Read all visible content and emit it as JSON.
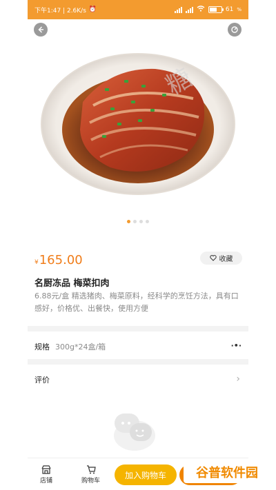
{
  "status_bar": {
    "time_speed": "下午1:47 | 2.6K/s",
    "battery": "61",
    "battery_level": 0.61
  },
  "product": {
    "price_symbol": "¥",
    "price": "165.00",
    "favorite_label": "收藏",
    "title": "名厨冻品  梅菜扣肉",
    "description": "6.88元/盒  精选猪肉、梅菜原料，经科学的烹饪方法，具有口感好，价格优、出餐快，使用方便"
  },
  "spec": {
    "label": "规格",
    "value": "300g*24盒/箱"
  },
  "review": {
    "label": "评价"
  },
  "tabbar": {
    "shop_label": "店铺",
    "cart_label": "购物车",
    "add_to_cart_label": "加入购物车"
  },
  "watermark": {
    "text": "谷普软件园"
  },
  "icons": {
    "back": "back-arrow-icon",
    "share": "share-icon",
    "favorite": "heart-icon",
    "shop": "shop-icon",
    "cart": "cart-icon",
    "chevron": "chevron-right-icon",
    "empty_review": "chat-bubbles-icon"
  },
  "colors": {
    "accent": "#f39b2f",
    "price": "#f07d1a",
    "add_to_cart": "#f5b400"
  }
}
